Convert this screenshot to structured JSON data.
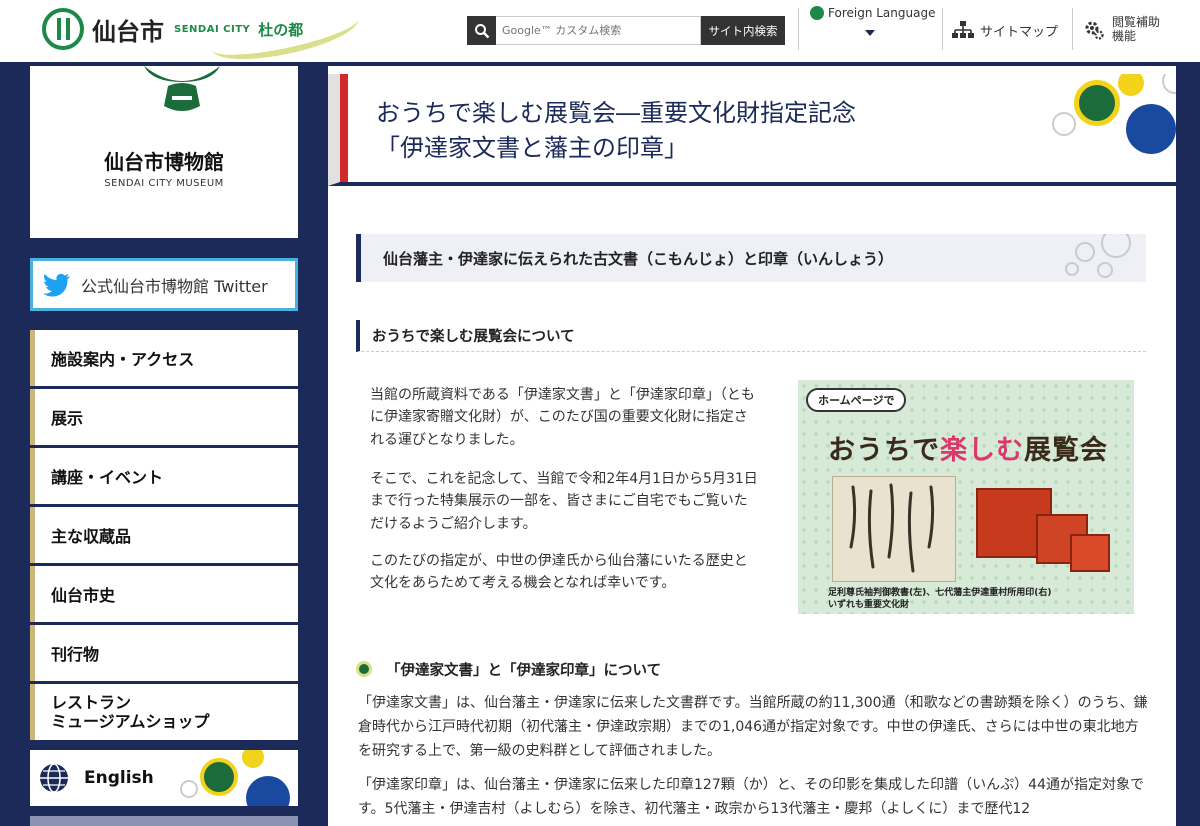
{
  "header": {
    "city_name": "仙台市",
    "city_en": "SENDAI CITY",
    "city_slogan": "杜の都",
    "search_placeholder": "Google™ カスタム検索",
    "search_button": "サイト内検索",
    "foreign_language": "Foreign Language",
    "sitemap": "サイトマップ",
    "accessibility_line1": "閲覧補助",
    "accessibility_line2": "機能"
  },
  "sidebar": {
    "museum_name": "仙台市博物館",
    "museum_en": "SENDAI CITY MUSEUM",
    "twitter": "公式仙台市博物館 Twitter",
    "nav": [
      {
        "label": "施設案内・アクセス"
      },
      {
        "label": "展示"
      },
      {
        "label": "講座・イベント"
      },
      {
        "label": "主な収蔵品"
      },
      {
        "label": "仙台市史"
      },
      {
        "label": "刊行物"
      },
      {
        "label1": "レストラン",
        "label2": "ミュージアムショップ"
      }
    ],
    "english": "English"
  },
  "main": {
    "title_line1": "おうちで楽しむ展覧会―重要文化財指定記念",
    "title_line2": "「伊達家文書と藩主の印章」",
    "subtitle": "仙台藩主・伊達家に伝えられた古文書（こもんじょ）と印章（いんしょう）",
    "section1_heading": "おうちで楽しむ展覧会について",
    "para1": "当館の所蔵資料である「伊達家文書」と「伊達家印章」（ともに伊達家寄贈文化財）が、このたび国の重要文化財に指定される運びとなりました。",
    "para2": "そこで、これを記念して、当館で令和2年4月1日から5月31日まで行った特集展示の一部を、皆さまにご自宅でもご覧いただけるようご紹介します。",
    "para3": "このたびの指定が、中世の伊達氏から仙台藩にいたる歴史と文化をあらためて考える機会となれば幸いです。",
    "promo": {
      "bubble": "ホームページで",
      "title_pre": "おうちで",
      "title_hl": "楽しむ",
      "title_post": "展覧会",
      "caption1": "足利尊氏袖判御教書(左)、七代藩主伊達重村所用印(右)",
      "caption2": "いずれも重要文化財"
    },
    "section2_heading": "「伊達家文書」と「伊達家印章」について",
    "body1": "「伊達家文書」は、仙台藩主・伊達家に伝来した文書群です。当館所蔵の約11,300通（和歌などの書跡類を除く）のうち、鎌倉時代から江戸時代初期（初代藩主・伊達政宗期）までの1,046通が指定対象です。中世の伊達氏、さらには中世の東北地方を研究する上で、第一級の史料群として評価されました。",
    "body2": "「伊達家印章」は、仙台藩主・伊達家に伝来した印章127顆（か）と、その印影を集成した印譜（いんぷ）44通が指定対象です。5代藩主・伊達吉村（よしむら）を除き、初代藩主・政宗から13代藩主・慶邦（よしくに）まで歴代12"
  },
  "colors": {
    "navy": "#1b2a59",
    "green": "#1c8a47",
    "yellow": "#f2d21b",
    "blue": "#1a4aa0",
    "red": "#d02a2a"
  }
}
